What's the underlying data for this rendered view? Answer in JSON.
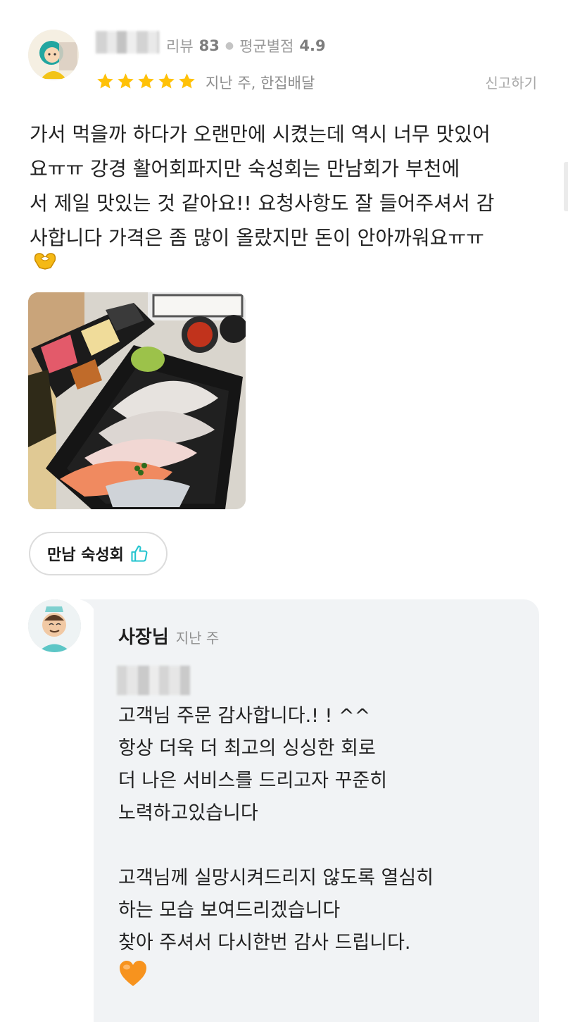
{
  "reviewer": {
    "review_count_label": "리뷰",
    "review_count": "83",
    "avg_rating_label": "평균별점",
    "avg_rating": "4.9",
    "rating_stars": 5,
    "time_and_order": "지난 주, 한집배달",
    "report_label": "신고하기"
  },
  "review": {
    "text": "가서 먹을까 하다가 오랜만에 시켰는데 역시 너무 맛있어\n요ㅠㅠ 강경 활어회파지만 숙성회는 만남회가 부천에\n서 제일 맛있는 것 같아요!! 요청사항도 잘 들어주셔서 감\n사합니다 가격은 좀 많이 올랐지만 돈이 안아까워요ㅠㅠ",
    "menu_chip": "만남 숙성회"
  },
  "reply": {
    "author": "사장님",
    "time": "지난 주",
    "text": "고객님 주문 감사합니다.! ! ^^\n항상 더욱 더 최고의 싱싱한 회로\n더 나은 서비스를 드리고자 꾸준히\n노력하고있습니다\n\n고객님께 실망시켜드리지 않도록 열심히\n하는 모습 보여드리겠습니다\n찾아 주셔서 다시한번 감사 드립니다."
  },
  "colors": {
    "star": "#ffc107",
    "reply_bg": "#f1f3f5",
    "thumb": "#23c4cf"
  },
  "icons": [
    "user-avatar",
    "star-icon",
    "heart-hands-icon",
    "thumbs-up-icon",
    "owner-avatar",
    "orange-heart-icon"
  ]
}
